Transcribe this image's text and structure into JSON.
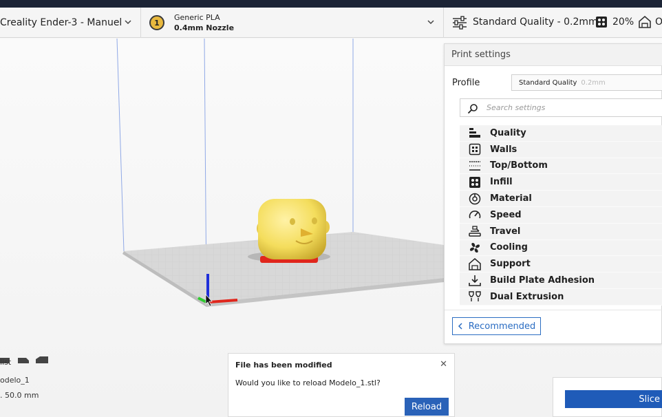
{
  "header": {
    "printer": {
      "name": "Creality Ender-3 - Manuel",
      "icon": "chevron-down-icon"
    },
    "material": {
      "extruder_number": "1",
      "name": "Generic PLA",
      "nozzle": "0.4mm Nozzle"
    },
    "quality": {
      "label": "Standard Quality - 0.2mm",
      "infill": "20%",
      "support": "O"
    }
  },
  "print_settings": {
    "title": "Print settings",
    "profile_label": "Profile",
    "profile_value": "Standard Quality",
    "profile_sub": "0.2mm",
    "search_placeholder": "Search settings",
    "categories": [
      {
        "label": "Quality",
        "icon": "quality-icon"
      },
      {
        "label": "Walls",
        "icon": "walls-icon"
      },
      {
        "label": "Top/Bottom",
        "icon": "top-bottom-icon"
      },
      {
        "label": "Infill",
        "icon": "infill-icon"
      },
      {
        "label": "Material",
        "icon": "material-icon"
      },
      {
        "label": "Speed",
        "icon": "speed-icon"
      },
      {
        "label": "Travel",
        "icon": "travel-icon"
      },
      {
        "label": "Cooling",
        "icon": "cooling-icon"
      },
      {
        "label": "Support",
        "icon": "support-icon"
      },
      {
        "label": "Build Plate Adhesion",
        "icon": "build-plate-adhesion-icon"
      },
      {
        "label": "Dual Extrusion",
        "icon": "dual-extrusion-icon"
      }
    ],
    "recommended_label": "Recommended"
  },
  "object_list": {
    "title": "list",
    "item": "odelo_1",
    "dims": ". 50.0 mm"
  },
  "toast": {
    "title": "File has been modified",
    "message": "Would you like to reload Modelo_1.stl?",
    "button": "Reload",
    "close": "✕"
  },
  "slice": {
    "label": "Slice"
  },
  "colors": {
    "accent": "#2a62b8",
    "model": "#f5e163",
    "axis_x": "#e0261c",
    "axis_z": "#1f2fd9",
    "axis_y": "#2ecc2e"
  }
}
